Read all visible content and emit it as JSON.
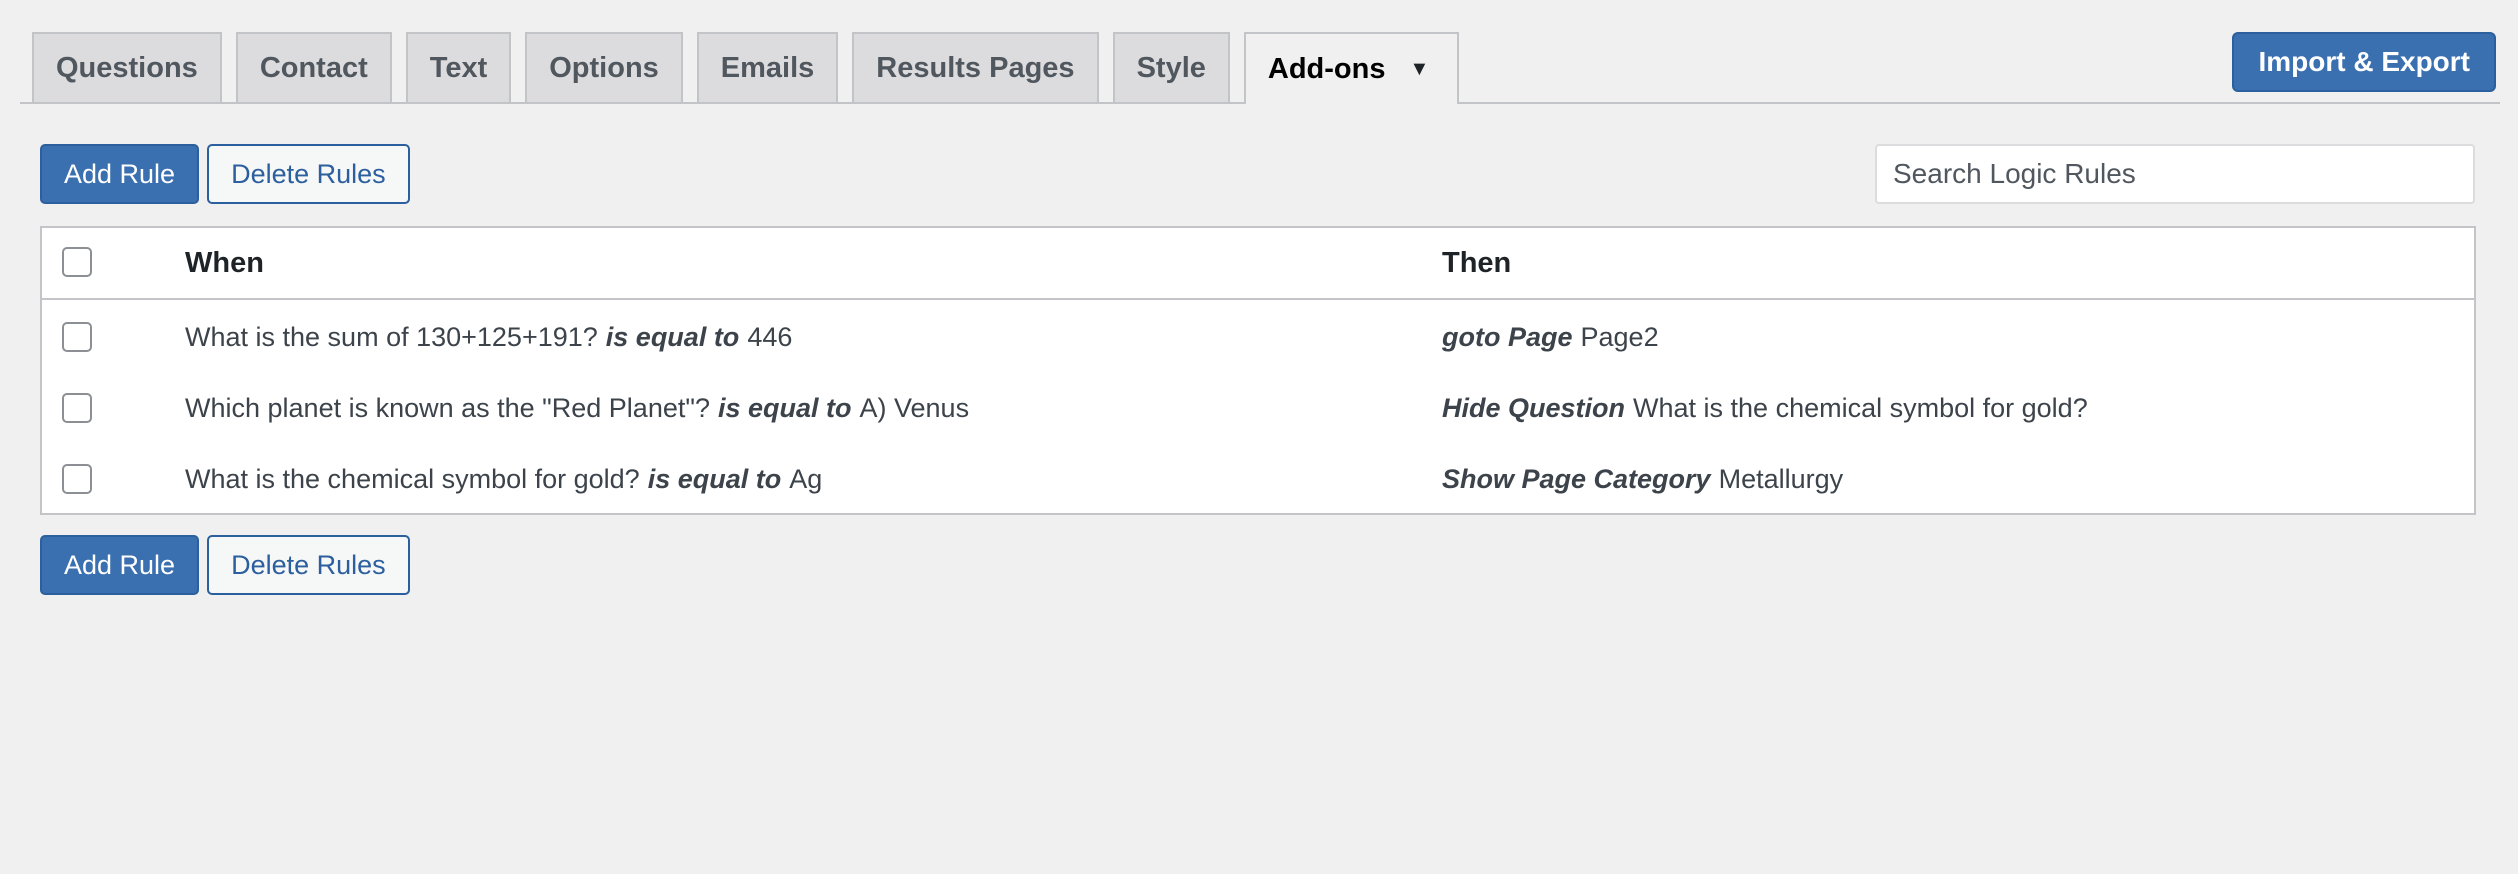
{
  "tabs": [
    {
      "label": "Questions",
      "name": "tab-questions"
    },
    {
      "label": "Contact",
      "name": "tab-contact"
    },
    {
      "label": "Text",
      "name": "tab-text"
    },
    {
      "label": "Options",
      "name": "tab-options"
    },
    {
      "label": "Emails",
      "name": "tab-emails"
    },
    {
      "label": "Results Pages",
      "name": "tab-results-pages"
    },
    {
      "label": "Style",
      "name": "tab-style"
    },
    {
      "label": "Add-ons",
      "name": "tab-add-ons",
      "active": true
    }
  ],
  "header": {
    "import_export_label": "Import & Export"
  },
  "toolbar": {
    "add_rule_label": "Add Rule",
    "delete_rules_label": "Delete Rules"
  },
  "search": {
    "placeholder": "Search Logic Rules",
    "value": ""
  },
  "table": {
    "columns": {
      "when": "When",
      "then": "Then"
    },
    "rows": [
      {
        "when_question": "What is the sum of 130+125+191?",
        "when_operator": "is equal to",
        "when_value": "446",
        "then_action": "goto Page",
        "then_target": "Page2"
      },
      {
        "when_question": "Which planet is known as the \"Red Planet\"?",
        "when_operator": "is equal to",
        "when_value": "A) Venus",
        "then_action": "Hide Question",
        "then_target": "What is the chemical symbol for gold?"
      },
      {
        "when_question": "What is the chemical symbol for gold?",
        "when_operator": "is equal to",
        "when_value": "Ag",
        "then_action": "Show Page Category",
        "then_target": "Metallurgy"
      }
    ]
  },
  "colors": {
    "primary": "#3a6fb0",
    "background": "#f0f0f1",
    "tab_inactive": "#dcdcde"
  },
  "icons": {
    "dropdown_caret": "caret-down-icon"
  }
}
